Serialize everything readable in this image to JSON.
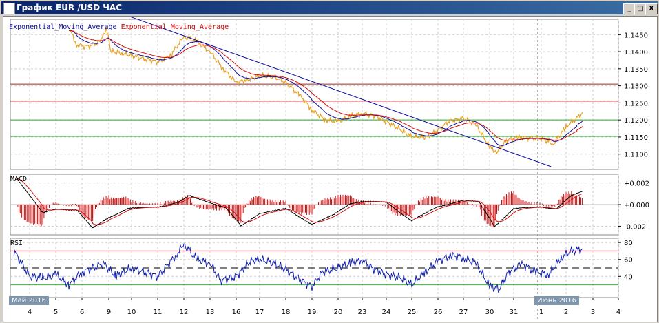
{
  "window": {
    "title": "График EUR /USD  ЧАС",
    "buttons": [
      "_",
      "□",
      "X"
    ]
  },
  "legend": {
    "ema1": "Exponential_Moving_Average",
    "ema2": "Exponential_Moving_Average"
  },
  "colors": {
    "price": "#e8a020",
    "ema_fast": "#1010a0",
    "ema_slow": "#d01010",
    "resistance": "#b02020",
    "support": "#20b020",
    "trend": "#1010a0"
  },
  "chart_data": [
    {
      "type": "line",
      "title": "EUR/USD H1",
      "ylim": [
        1.1055,
        1.1495
      ],
      "yticks": [
        "1.1450",
        "1.1400",
        "1.1350",
        "1.1300",
        "1.1250",
        "1.1200",
        "1.1150",
        "1.1100"
      ],
      "ytick_values": [
        1.145,
        1.14,
        1.135,
        1.13,
        1.125,
        1.12,
        1.115,
        1.11
      ],
      "x_ticks": [
        "4",
        "5",
        "6",
        "9",
        "10",
        "11",
        "12",
        "13",
        "16",
        "17",
        "18",
        "19",
        "20",
        "23",
        "24",
        "25",
        "26",
        "27",
        "30",
        "31",
        "1",
        "2",
        "3",
        "4"
      ],
      "months": [
        "Май 2016",
        "Июнь 2016"
      ],
      "price": [
        [
          1.5,
          1.147
        ],
        [
          1.8,
          1.142
        ],
        [
          2.2,
          1.1415
        ],
        [
          2.7,
          1.143
        ],
        [
          2.9,
          1.147
        ],
        [
          3.1,
          1.14
        ],
        [
          3.6,
          1.1395
        ],
        [
          4.2,
          1.1385
        ],
        [
          5,
          1.137
        ],
        [
          5.5,
          1.139
        ],
        [
          6,
          1.1445
        ],
        [
          6.5,
          1.143
        ],
        [
          7,
          1.14
        ],
        [
          7.5,
          1.135
        ],
        [
          8,
          1.131
        ],
        [
          8.6,
          1.132
        ],
        [
          9,
          1.133
        ],
        [
          9.6,
          1.1325
        ],
        [
          10,
          1.131
        ],
        [
          10.5,
          1.1275
        ],
        [
          11,
          1.123
        ],
        [
          11.5,
          1.12
        ],
        [
          12,
          1.1195
        ],
        [
          12.5,
          1.121
        ],
        [
          13,
          1.122
        ],
        [
          13.6,
          1.121
        ],
        [
          14,
          1.1195
        ],
        [
          14.6,
          1.117
        ],
        [
          15,
          1.115
        ],
        [
          15.6,
          1.115
        ],
        [
          16,
          1.117
        ],
        [
          16.4,
          1.1195
        ],
        [
          17,
          1.1205
        ],
        [
          17.5,
          1.1185
        ],
        [
          18,
          1.112
        ],
        [
          18.3,
          1.1105
        ],
        [
          18.7,
          1.114
        ],
        [
          19.2,
          1.115
        ],
        [
          20,
          1.1145
        ],
        [
          20.5,
          1.113
        ],
        [
          21,
          1.118
        ],
        [
          21.4,
          1.1205
        ],
        [
          21.6,
          1.122
        ]
      ],
      "levels": {
        "resistance": [
          1.1305,
          1.1255
        ],
        "support": [
          1.12,
          1.1152
        ]
      },
      "trendline": [
        [
          3.0,
          1.1525
        ],
        [
          20.4,
          1.1063
        ]
      ]
    },
    {
      "type": "line",
      "title": "MACD",
      "ylim": [
        -0.0028,
        0.0028
      ],
      "yticks": [
        "+0.002",
        "+0.000",
        "-0.002"
      ],
      "ytick_values": [
        0.002,
        0,
        -0.002
      ],
      "macd": [
        [
          -0.5,
          0.0025
        ],
        [
          0.5,
          -0.0008
        ],
        [
          1,
          -0.0004
        ],
        [
          1.8,
          -0.0005
        ],
        [
          2.4,
          -0.0022
        ],
        [
          3,
          -0.0012
        ],
        [
          3.8,
          -0.0004
        ],
        [
          5,
          -0.0002
        ],
        [
          5.8,
          0.0002
        ],
        [
          6.2,
          0.0008
        ],
        [
          7,
          0.0002
        ],
        [
          7.6,
          -0.0003
        ],
        [
          8.2,
          -0.002
        ],
        [
          9,
          -0.0008
        ],
        [
          10,
          -0.0004
        ],
        [
          11,
          -0.0018
        ],
        [
          11.8,
          -0.001
        ],
        [
          12.5,
          0.0001
        ],
        [
          13,
          0.0003
        ],
        [
          14,
          0.0002
        ],
        [
          15,
          -0.0015
        ],
        [
          16,
          -0.0002
        ],
        [
          17,
          0.0004
        ],
        [
          17.6,
          0.0002
        ],
        [
          18.2,
          -0.002
        ],
        [
          19,
          -0.0004
        ],
        [
          20,
          -0.0002
        ],
        [
          20.6,
          -0.0004
        ],
        [
          21.2,
          0.0008
        ],
        [
          21.6,
          0.0012
        ]
      ]
    },
    {
      "type": "line",
      "title": "RSI",
      "ylim": [
        15,
        85
      ],
      "yticks": [
        "80",
        "60",
        "40"
      ],
      "ytick_values": [
        80,
        60,
        40
      ],
      "levels": [
        70,
        50,
        30
      ],
      "rsi": [
        [
          -0.6,
          70
        ],
        [
          0,
          40
        ],
        [
          0.5,
          38
        ],
        [
          1,
          42
        ],
        [
          1.5,
          30
        ],
        [
          2,
          45
        ],
        [
          2.8,
          55
        ],
        [
          3.3,
          40
        ],
        [
          4,
          50
        ],
        [
          5,
          40
        ],
        [
          5.7,
          65
        ],
        [
          6,
          78
        ],
        [
          6.5,
          60
        ],
        [
          7,
          55
        ],
        [
          7.4,
          35
        ],
        [
          8,
          40
        ],
        [
          8.6,
          58
        ],
        [
          9,
          60
        ],
        [
          9.6,
          55
        ],
        [
          10,
          48
        ],
        [
          10.6,
          35
        ],
        [
          11,
          28
        ],
        [
          11.4,
          45
        ],
        [
          12,
          50
        ],
        [
          12.5,
          55
        ],
        [
          13,
          60
        ],
        [
          13.4,
          50
        ],
        [
          14,
          42
        ],
        [
          14.6,
          38
        ],
        [
          15,
          30
        ],
        [
          15.5,
          45
        ],
        [
          16,
          58
        ],
        [
          16.5,
          65
        ],
        [
          17,
          62
        ],
        [
          17.5,
          55
        ],
        [
          18,
          28
        ],
        [
          18.4,
          25
        ],
        [
          18.8,
          45
        ],
        [
          19.3,
          55
        ],
        [
          19.8,
          45
        ],
        [
          20.3,
          42
        ],
        [
          20.8,
          62
        ],
        [
          21.2,
          70
        ],
        [
          21.6,
          72
        ]
      ]
    }
  ]
}
